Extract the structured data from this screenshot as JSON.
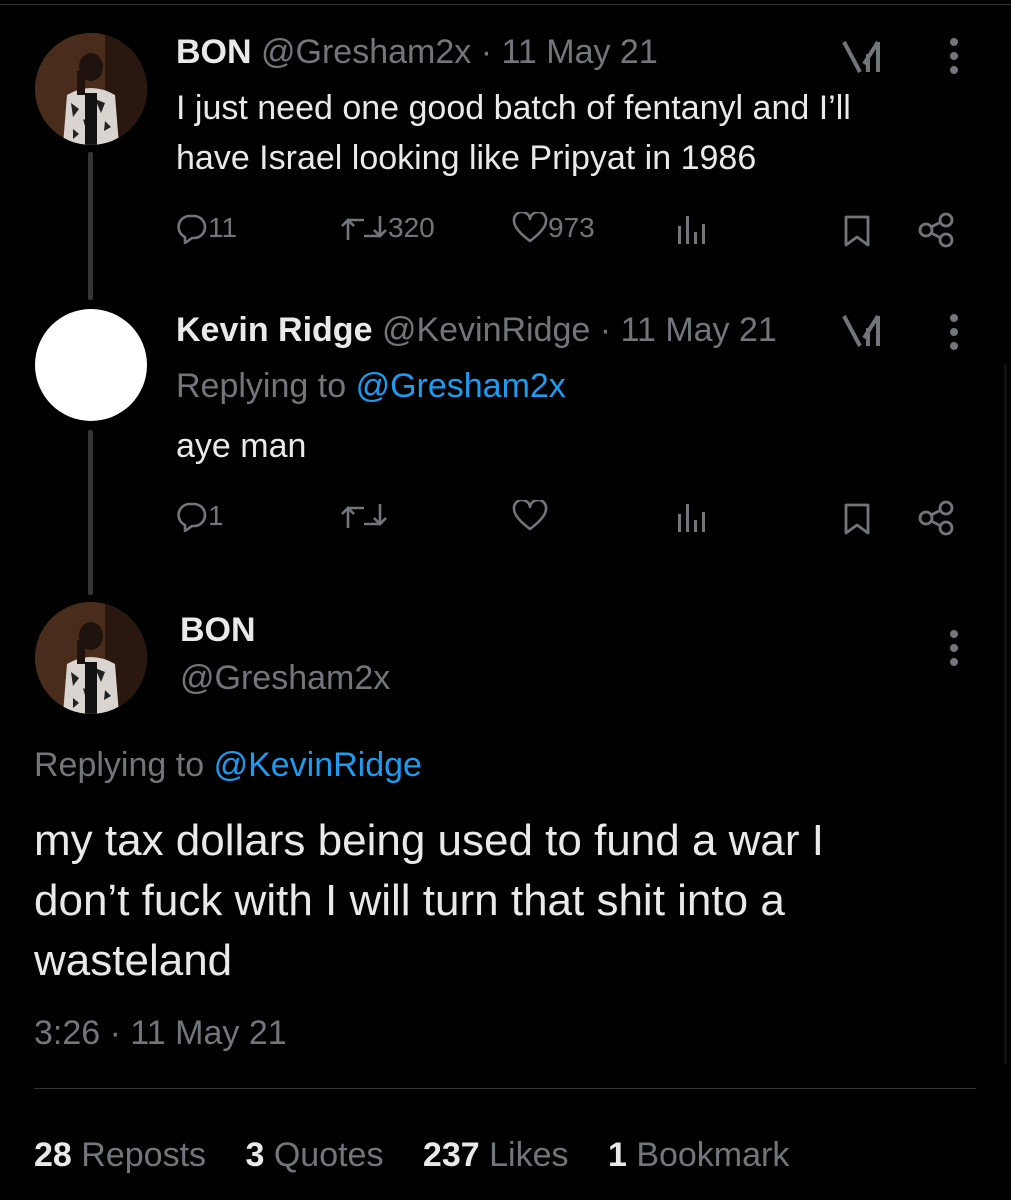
{
  "tweet1": {
    "display_name": "BON",
    "handle": "@Gresham2x",
    "separator": "·",
    "date": "11 May 21",
    "text_line1": "I just need one good batch of fentanyl and I’ll",
    "text_line2": "have Israel looking like Pripyat in 1986",
    "replies": "11",
    "reposts": "320",
    "likes": "973"
  },
  "tweet2": {
    "display_name": "Kevin Ridge",
    "handle": "@KevinRidge",
    "separator": "·",
    "date": "11 May 21",
    "replying_prefix": "Replying to",
    "replying_handle": "@Gresham2x",
    "text": "aye man",
    "replies": "1"
  },
  "main_tweet": {
    "display_name": "BON",
    "handle": "@Gresham2x",
    "replying_prefix": "Replying to",
    "replying_handle": "@KevinRidge",
    "text_line1": "my tax dollars being used to fund a war I",
    "text_line2": "don’t fuck with I will turn that shit into a",
    "text_line3": "wasteland",
    "time": "3:26",
    "separator": "·",
    "date": "11 May 21"
  },
  "stats": {
    "reposts_count": "28",
    "reposts_label": "Reposts",
    "quotes_count": "3",
    "quotes_label": "Quotes",
    "likes_count": "237",
    "likes_label": "Likes",
    "bookmarks_count": "1",
    "bookmarks_label": "Bookmark"
  },
  "icons": {
    "reply": "reply-icon",
    "repost": "repost-icon",
    "like": "heart-icon",
    "views": "views-icon",
    "bookmark": "bookmark-icon",
    "share": "share-icon",
    "grok": "grok-icon",
    "more": "more-icon"
  },
  "colors": {
    "background": "#000000",
    "text": "#e7e9ea",
    "muted": "#71767b",
    "link": "#1d9bf0"
  }
}
